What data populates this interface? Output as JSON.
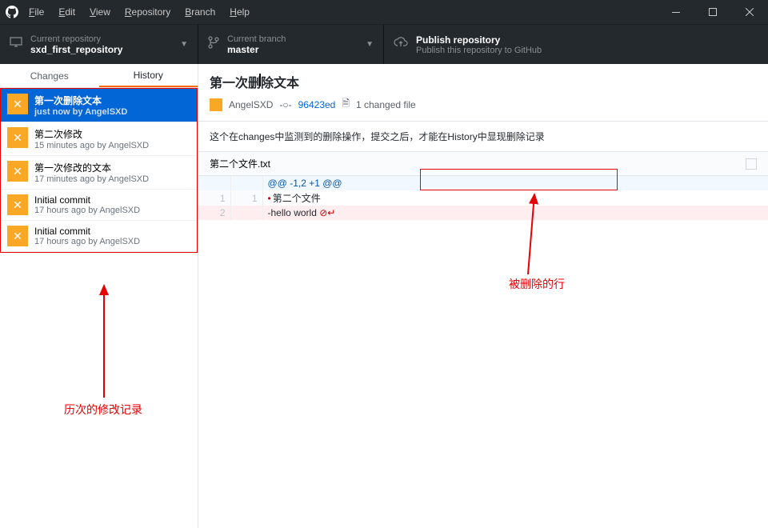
{
  "menu": {
    "file": "File",
    "edit": "Edit",
    "view": "View",
    "repository": "Repository",
    "branch": "Branch",
    "help": "Help"
  },
  "toolbar": {
    "repo_label": "Current repository",
    "repo_value": "sxd_first_repository",
    "branch_label": "Current branch",
    "branch_value": "master",
    "publish_title": "Publish repository",
    "publish_sub": "Publish this repository to GitHub"
  },
  "tabs": {
    "changes": "Changes",
    "history": "History"
  },
  "commits": [
    {
      "title": "第一次删除文本",
      "sub": "just now by AngelSXD"
    },
    {
      "title": "第二次修改",
      "sub": "15 minutes ago by AngelSXD"
    },
    {
      "title": "第一次修改的文本",
      "sub": "17 minutes ago by AngelSXD"
    },
    {
      "title": "Initial commit",
      "sub": "17 hours ago by AngelSXD"
    },
    {
      "title": "Initial commit",
      "sub": "17 hours ago by AngelSXD"
    }
  ],
  "detail": {
    "title": "第一次删除文本",
    "author": "AngelSXD",
    "hash": "96423ed",
    "changed": "1 changed file",
    "desc": "这个在changes中监测到的删除操作，提交之后，才能在History中显现删除记录",
    "file": "第二个文件.txt",
    "hunk": "@@ -1,2 +1 @@",
    "line_ctx": "第二个文件",
    "line_del": "hello world",
    "ln_old_1": "1",
    "ln_new_1": "1",
    "ln_old_2": "2"
  },
  "annotations": {
    "history_label": "历次的修改记录",
    "deleted_label": "被删除的行"
  }
}
